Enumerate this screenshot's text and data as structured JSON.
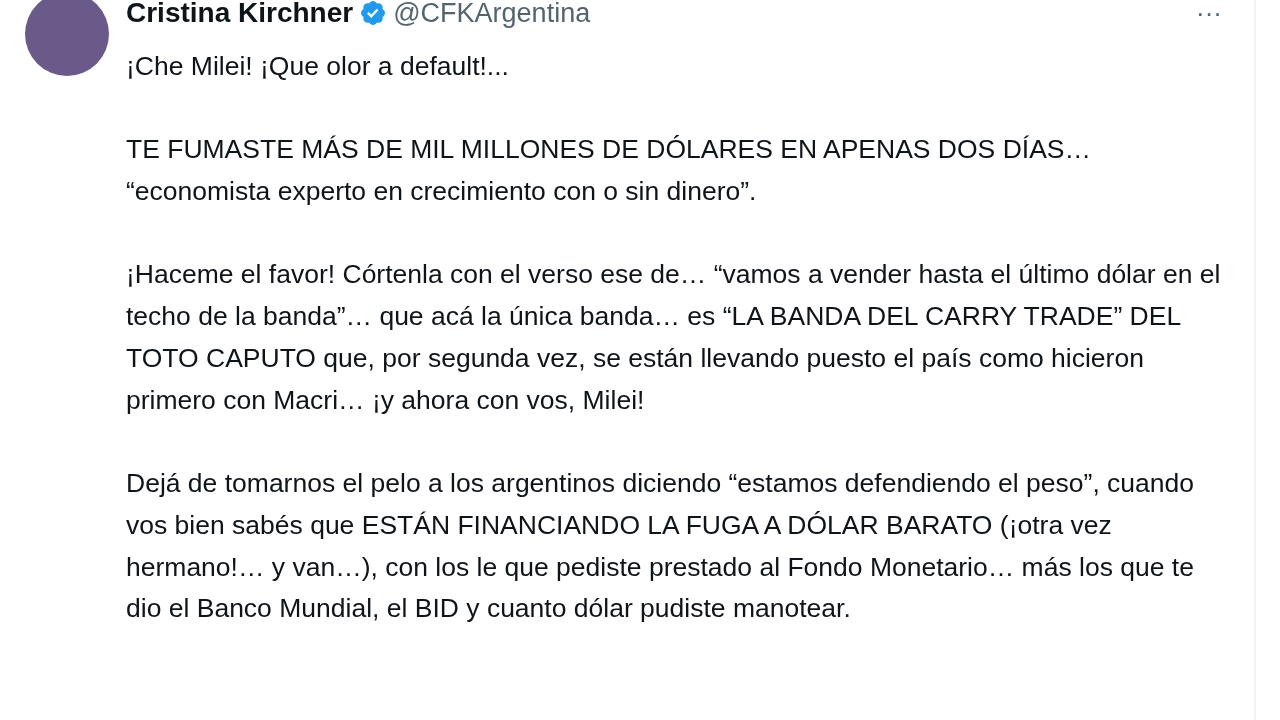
{
  "tweet": {
    "author": {
      "name": "Cristina Kirchner",
      "verified": true,
      "handle": "@CFKArgentina"
    },
    "more_button": "···",
    "paragraphs": [
      "¡Che Milei! ¡Que olor a default!...",
      "TE FUMASTE MÁS DE MIL MILLONES DE DÓLARES EN APENAS DOS DÍAS… “economista experto en crecimiento con o sin dinero”.",
      "¡Haceme el favor! Córtenla con el verso ese de… “vamos a vender hasta el último dólar en el techo de la banda”… que acá la única banda… es “LA BANDA DEL CARRY TRADE” DEL TOTO CAPUTO que, por segunda vez, se están llevando puesto el país como hicieron primero con Macri… ¡y ahora con vos, Milei!",
      "Dejá de tomarnos el pelo a los argentinos diciendo “estamos defendiendo el peso”, cuando vos bien sabés que ESTÁN FINANCIANDO LA FUGA A DÓLAR BARATO (¡otra vez hermano!… y van…), con los le que pediste prestado al Fondo Monetario… más los que te dio el Banco Mundial, el BID y cuanto dólar pudiste manotear."
    ]
  }
}
